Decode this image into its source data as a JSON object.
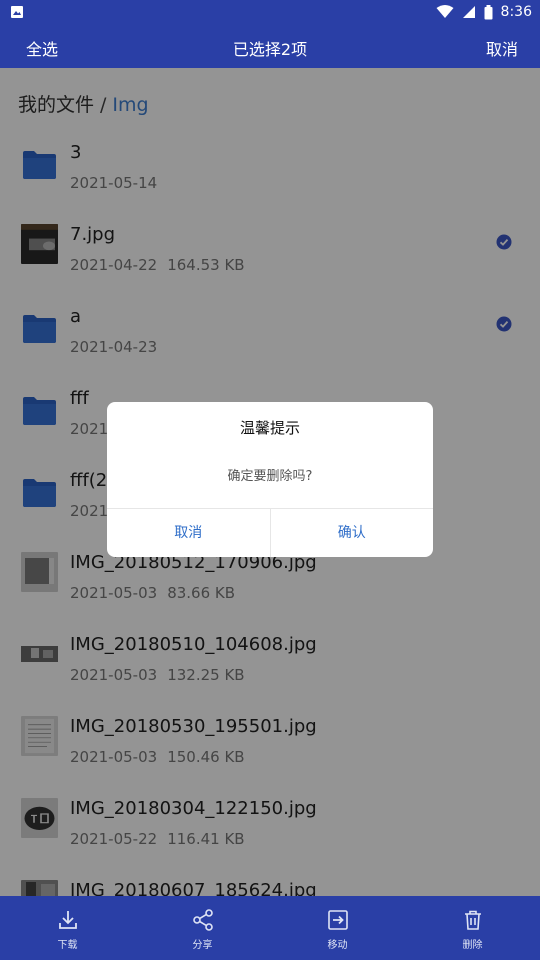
{
  "status_bar": {
    "time": "8:36"
  },
  "top_bar": {
    "select_all": "全选",
    "title": "已选择2项",
    "cancel": "取消"
  },
  "breadcrumb": {
    "root": "我的文件",
    "separator": "/",
    "current": "Img"
  },
  "files": [
    {
      "name": "3",
      "date": "2021-05-14",
      "size": "",
      "kind": "folder",
      "selected": false
    },
    {
      "name": "7.jpg",
      "date": "2021-04-22",
      "size": "164.53 KB",
      "kind": "image",
      "selected": true
    },
    {
      "name": "a",
      "date": "2021-04-23",
      "size": "",
      "kind": "folder",
      "selected": true
    },
    {
      "name": "fff",
      "date": "2021-",
      "size": "",
      "kind": "folder",
      "selected": false
    },
    {
      "name": "fff(2",
      "date": "2021",
      "size": "",
      "kind": "folder",
      "selected": false
    },
    {
      "name": "IMG_20180512_170906.jpg",
      "date": "2021-05-03",
      "size": "83.66 KB",
      "kind": "image",
      "selected": false
    },
    {
      "name": "IMG_20180510_104608.jpg",
      "date": "2021-05-03",
      "size": "132.25 KB",
      "kind": "image",
      "selected": false
    },
    {
      "name": "IMG_20180530_195501.jpg",
      "date": "2021-05-03",
      "size": "150.46 KB",
      "kind": "image",
      "selected": false
    },
    {
      "name": "IMG_20180304_122150.jpg",
      "date": "2021-05-22",
      "size": "116.41 KB",
      "kind": "image",
      "selected": false
    },
    {
      "name": "IMG_20180607_185624.jpg",
      "date": "",
      "size": "",
      "kind": "image",
      "selected": false
    }
  ],
  "bottom_bar": {
    "download": "下载",
    "share": "分享",
    "move": "移动",
    "delete": "删除"
  },
  "dialog": {
    "title": "温馨提示",
    "message": "确定要删除吗?",
    "cancel": "取消",
    "confirm": "确认"
  },
  "colors": {
    "primary": "#2a3fa6",
    "folder": "#2b62c6",
    "check": "#3b57c4",
    "link": "#2f6ec9"
  }
}
